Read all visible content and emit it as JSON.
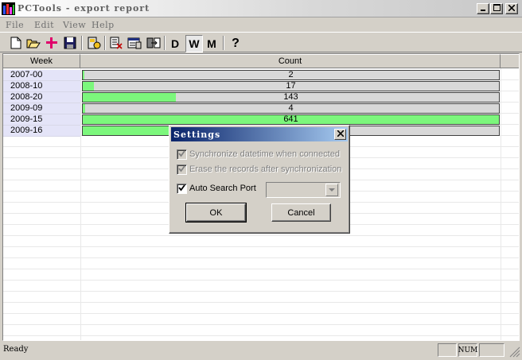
{
  "window": {
    "title": "PCTools - export report"
  },
  "caption_buttons": [
    "minimize",
    "maximize",
    "close"
  ],
  "menu": [
    "File",
    "Edit",
    "View",
    "Help"
  ],
  "toolbar": {
    "icons": [
      "new-file-icon",
      "open-folder-icon",
      "add-plus-icon",
      "save-disk-icon",
      "connect-device-icon",
      "delete-record-icon",
      "properties-icon",
      "export-icon"
    ],
    "letters": {
      "day": "D",
      "week": "W",
      "month": "M"
    },
    "help": "?",
    "active_period": "W",
    "plus_color": "#e0006a"
  },
  "grid": {
    "columns": [
      "Week",
      "Count"
    ],
    "max_count": 641,
    "bar_color": "#7cf77c",
    "rows": [
      {
        "week": "2007-00",
        "count": 2,
        "count_label": "2"
      },
      {
        "week": "2008-10",
        "count": 17,
        "count_label": "17"
      },
      {
        "week": "2008-20",
        "count": 143,
        "count_label": "143"
      },
      {
        "week": "2009-09",
        "count": 4,
        "count_label": "4"
      },
      {
        "week": "2009-15",
        "count": 641,
        "count_label": "641"
      },
      {
        "week": "2009-16",
        "count": 140,
        "count_label": ""
      }
    ]
  },
  "status": {
    "text": "Ready",
    "num": "NUM"
  },
  "dialog": {
    "title": "Settings",
    "sync_datetime": {
      "label": "Synchronize datetime when connected",
      "checked": true,
      "enabled": false
    },
    "erase_records": {
      "label": "Erase the records after synchronization",
      "checked": true,
      "enabled": false
    },
    "auto_search": {
      "label": "Auto Search Port",
      "checked": true,
      "enabled": true
    },
    "port_value": "",
    "ok_label": "OK",
    "cancel_label": "Cancel"
  }
}
